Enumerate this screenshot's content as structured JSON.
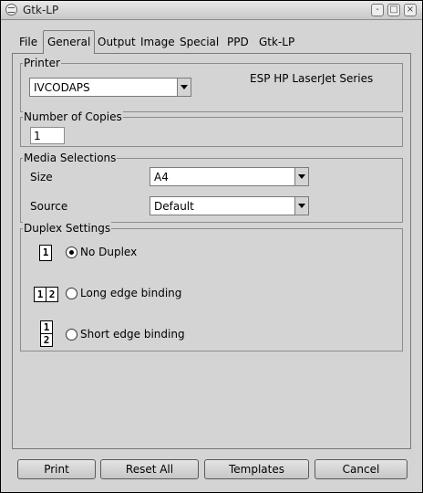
{
  "window": {
    "title": "Gtk-LP",
    "buttons": [
      "-",
      "□",
      "×"
    ]
  },
  "tabs": [
    {
      "label": "File"
    },
    {
      "label": "General"
    },
    {
      "label": "Output"
    },
    {
      "label": "Image"
    },
    {
      "label": "Special"
    },
    {
      "label": "PPD"
    },
    {
      "label": "Gtk-LP"
    }
  ],
  "active_tab": "General",
  "printer": {
    "legend": "Printer",
    "selected": "IVCODAPS",
    "description": "ESP HP LaserJet Series"
  },
  "copies": {
    "legend": "Number of Copies",
    "value": "1"
  },
  "media": {
    "legend": "Media Selections",
    "size_label": "Size",
    "size_value": "A4",
    "source_label": "Source",
    "source_value": "Default"
  },
  "duplex": {
    "legend": "Duplex Settings",
    "options": [
      {
        "label": "No Duplex",
        "icon": "1",
        "checked": true
      },
      {
        "label": "Long edge binding",
        "icon_a": "1",
        "icon_b": "2",
        "checked": false
      },
      {
        "label": "Short edge binding",
        "icon_a": "1",
        "icon_b": "2",
        "checked": false
      }
    ]
  },
  "buttons": {
    "print": "Print",
    "reset_all": "Reset All",
    "templates": "Templates",
    "cancel": "Cancel"
  }
}
